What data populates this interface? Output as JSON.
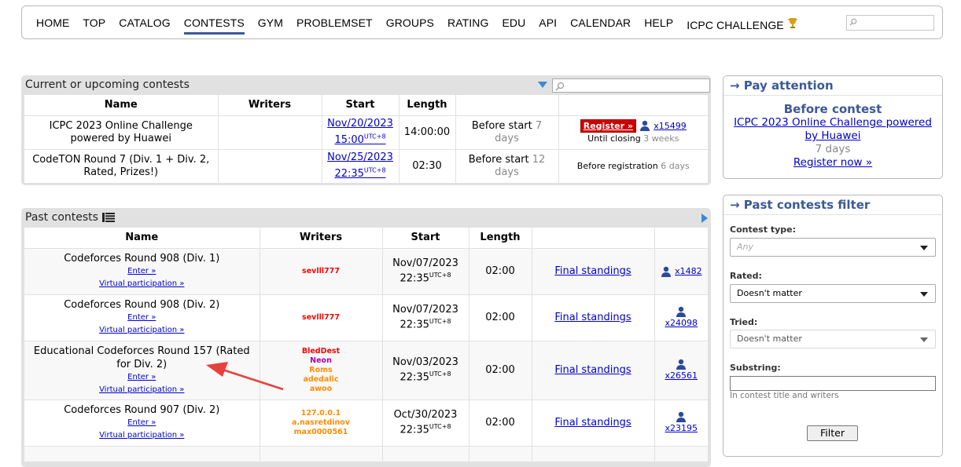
{
  "menu": {
    "items": [
      "HOME",
      "TOP",
      "CATALOG",
      "CONTESTS",
      "GYM",
      "PROBLEMSET",
      "GROUPS",
      "RATING",
      "EDU",
      "API",
      "CALENDAR",
      "HELP",
      "ICPC CHALLENGE"
    ],
    "active": "CONTESTS"
  },
  "current": {
    "caption": "Current or upcoming contests",
    "headers": [
      "Name",
      "Writers",
      "Start",
      "Length",
      "",
      ""
    ],
    "rows": [
      {
        "name": "ICPC 2023 Online Challenge powered by Huawei",
        "writers": "",
        "start_date": "Nov/20/2023",
        "start_time": "15:00",
        "utc": "UTC+8",
        "length": "14:00:00",
        "before_label": "Before start",
        "before_value": "7 days",
        "register": "Register »",
        "count": "x15499",
        "closing_label": "Until closing",
        "closing_value": "3 weeks"
      },
      {
        "name": "CodeTON Round 7 (Div. 1 + Div. 2, Rated, Prizes!)",
        "writers": "",
        "start_date": "Nov/25/2023",
        "start_time": "22:35",
        "utc": "UTC+8",
        "length": "02:30",
        "before_label": "Before start",
        "before_value": "12 days",
        "registration_label": "Before registration",
        "registration_value": "6 days"
      }
    ]
  },
  "past": {
    "caption": "Past contests",
    "headers": [
      "Name",
      "Writers",
      "Start",
      "Length",
      "",
      ""
    ],
    "enter": "Enter »",
    "virtual": "Virtual participation »",
    "standings": "Final standings",
    "rows": [
      {
        "name": "Codeforces Round 908 (Div. 1)",
        "writers": [
          {
            "n": "sevlll777",
            "c": "#ff0000"
          }
        ],
        "date": "Nov/07/2023",
        "time": "22:35",
        "utc": "UTC+8",
        "length": "02:00",
        "count": "x1482"
      },
      {
        "name": "Codeforces Round 908 (Div. 2)",
        "writers": [
          {
            "n": "sevlll777",
            "c": "#ff0000"
          }
        ],
        "date": "Nov/07/2023",
        "time": "22:35",
        "utc": "UTC+8",
        "length": "02:00",
        "count": "x24098"
      },
      {
        "name": "Educational Codeforces Round 157 (Rated for Div. 2)",
        "writers": [
          {
            "n": "BledDest",
            "c": "#ff0000"
          },
          {
            "n": "Neon",
            "c": "#aa00aa"
          },
          {
            "n": "Roms",
            "c": "#ff8c00"
          },
          {
            "n": "adedalic",
            "c": "#ff8c00"
          },
          {
            "n": "awoo",
            "c": "#ff8c00"
          }
        ],
        "date": "Nov/03/2023",
        "time": "22:35",
        "utc": "UTC+8",
        "length": "02:00",
        "count": "x26561"
      },
      {
        "name": "Codeforces Round 907 (Div. 2)",
        "writers": [
          {
            "n": "127.0.0.1",
            "c": "#ff8c00"
          },
          {
            "n": "a.nasretdinov",
            "c": "#ff8c00"
          },
          {
            "n": "max0000561",
            "c": "#ff8c00"
          }
        ],
        "date": "Oct/30/2023",
        "time": "22:35",
        "utc": "UTC+8",
        "length": "02:00",
        "count": "x23195"
      }
    ]
  },
  "pay_attention": {
    "title": "→ Pay attention",
    "subtitle": "Before contest",
    "contest_line1": "ICPC 2023 Online Challenge powered",
    "contest_line2": "by Huawei",
    "days": "7 days",
    "register": "Register now »"
  },
  "filter": {
    "title": "→ Past contests filter",
    "contest_type_label": "Contest type:",
    "contest_type_value": "Any",
    "rated_label": "Rated:",
    "rated_value": "Doesn't matter",
    "tried_label": "Tried:",
    "tried_value": "Doesn't matter",
    "substring_label": "Substring:",
    "substring_hint": "In contest title and writers",
    "button": "Filter"
  },
  "colors": {
    "accent": "#3b5998",
    "link": "#0000cc",
    "annotation_arrow": "#e8413c"
  }
}
